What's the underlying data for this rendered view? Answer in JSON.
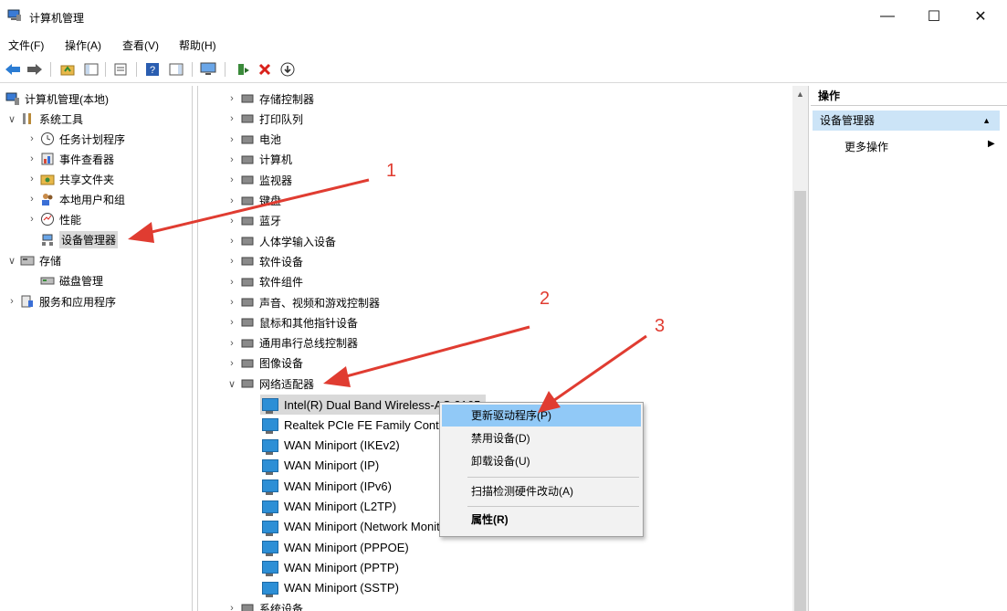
{
  "window": {
    "title": "计算机管理",
    "min_glyph": "—",
    "max_glyph": "☐",
    "close_glyph": "✕"
  },
  "menu": [
    "文件(F)",
    "操作(A)",
    "查看(V)",
    "帮助(H)"
  ],
  "left_tree": [
    {
      "label": "计算机管理(本地)",
      "chev": "",
      "icon": "computer-icon"
    },
    {
      "label": "系统工具",
      "chev": "∨",
      "icon": "tools-icon"
    },
    {
      "label": "任务计划程序",
      "chev": "›",
      "icon": "clock-icon"
    },
    {
      "label": "事件查看器",
      "chev": "›",
      "icon": "event-viewer-icon"
    },
    {
      "label": "共享文件夹",
      "chev": "›",
      "icon": "shared-folder-icon"
    },
    {
      "label": "本地用户和组",
      "chev": "›",
      "icon": "users-icon"
    },
    {
      "label": "性能",
      "chev": "›",
      "icon": "performance-icon"
    },
    {
      "label": "设备管理器",
      "chev": "",
      "icon": "device-manager-icon",
      "selected": true
    },
    {
      "label": "存储",
      "chev": "∨",
      "icon": "storage-icon"
    },
    {
      "label": "磁盘管理",
      "chev": "",
      "icon": "disk-icon"
    },
    {
      "label": "服务和应用程序",
      "chev": "›",
      "icon": "services-icon"
    }
  ],
  "categories": [
    "存储控制器",
    "打印队列",
    "电池",
    "计算机",
    "监视器",
    "键盘",
    "蓝牙",
    "人体学输入设备",
    "软件设备",
    "软件组件",
    "声音、视频和游戏控制器",
    "鼠标和其他指针设备",
    "通用串行总线控制器",
    "图像设备",
    "网络适配器"
  ],
  "adapters": [
    "Intel(R) Dual Band Wireless-AC 3165",
    "Realtek PCIe FE Family Controller",
    "WAN Miniport (IKEv2)",
    "WAN Miniport (IP)",
    "WAN Miniport (IPv6)",
    "WAN Miniport (L2TP)",
    "WAN Miniport (Network Monitor)",
    "WAN Miniport (PPPOE)",
    "WAN Miniport (PPTP)",
    "WAN Miniport (SSTP)"
  ],
  "last_category": "系统设备",
  "context_menu": {
    "update": "更新驱动程序(P)",
    "disable": "禁用设备(D)",
    "uninstall": "卸载设备(U)",
    "scan": "扫描检测硬件改动(A)",
    "properties": "属性(R)"
  },
  "actions": {
    "header": "操作",
    "section": "设备管理器",
    "more": "更多操作"
  },
  "annotations": [
    "1",
    "2",
    "3"
  ],
  "accent_color": "#e03c31"
}
